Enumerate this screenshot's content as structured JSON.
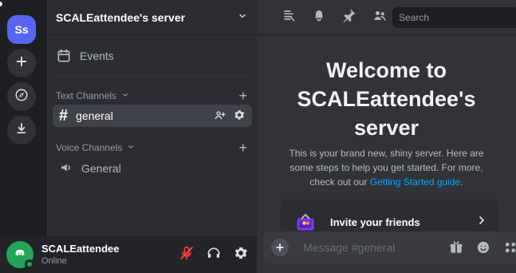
{
  "rail": {
    "active_server_label": "Ss"
  },
  "sidebar": {
    "server_title": "SCALEattendee's server",
    "events_label": "Events",
    "text_channels_label": "Text Channels",
    "voice_channels_label": "Voice Channels",
    "text_channels": [
      {
        "name": "general"
      }
    ],
    "voice_channels": [
      {
        "name": "General"
      }
    ]
  },
  "main": {
    "search_placeholder": "Search",
    "welcome_lines": [
      "Welcome to",
      "SCALEattendee's",
      "server"
    ],
    "subtitle_prefix": "This is your brand new, shiny server. Here are some steps to help you get started. For more, check out our ",
    "subtitle_link": "Getting Started guide",
    "subtitle_suffix": ".",
    "card_invite_label": "Invite your friends",
    "composer_placeholder": "Message #general"
  },
  "user": {
    "name": "SCALEattendee",
    "status": "Online"
  },
  "colors": {
    "accent": "#5865f2",
    "green": "#23a559",
    "red": "#f23f43",
    "link": "#00a8fc"
  },
  "icons": {
    "rail_add": "plus-icon",
    "rail_explore": "compass-icon",
    "rail_download": "download-icon",
    "events": "calendar-icon",
    "topbar_threads": "threads-icon",
    "topbar_notifications": "bell-icon",
    "topbar_pins": "pin-icon",
    "topbar_members": "members-icon",
    "user_mute": "microphone-muted-icon",
    "user_deafen": "headphones-icon",
    "user_settings": "gear-icon",
    "composer_gift": "gift-icon",
    "composer_emoji": "emoji-icon",
    "composer_apps": "apps-icon",
    "card_chevron": "chevron-right-icon"
  }
}
